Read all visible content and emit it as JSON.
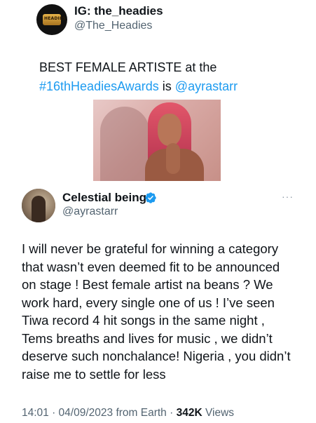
{
  "quoted": {
    "avatar_text": "HEADIES",
    "name": "IG: the_headies",
    "handle": "@The_Headies",
    "text_line1": "BEST FEMALE ARTISTE at the",
    "hashtag": "#16thHeadiesAwards",
    "text_is": " is ",
    "mention": "@ayrastarr"
  },
  "tweet": {
    "name": "Celestial being",
    "handle": "@ayrastarr",
    "more_label": "···",
    "lines": [
      "I will never be grateful for winning a category",
      "that wasn’t even deemed fit to be announced",
      "on stage ! Best female artist na beans ? We",
      "work hard, every single one of us ! I’ve seen",
      "Tiwa record 4 hit songs in the same night ,",
      "Tems breaths and lives for music , we didn’t",
      "deserve such nonchalance! Nigeria , you didn’t",
      "raise me to settle for less"
    ],
    "meta_prefix": "14:01 · 04/09/2023 from Earth · ",
    "views_count": "342K",
    "views_label": " Views"
  },
  "colors": {
    "link": "#1d9bf0",
    "secondary_text": "#536471",
    "verified_badge": "#1d9bf0"
  }
}
